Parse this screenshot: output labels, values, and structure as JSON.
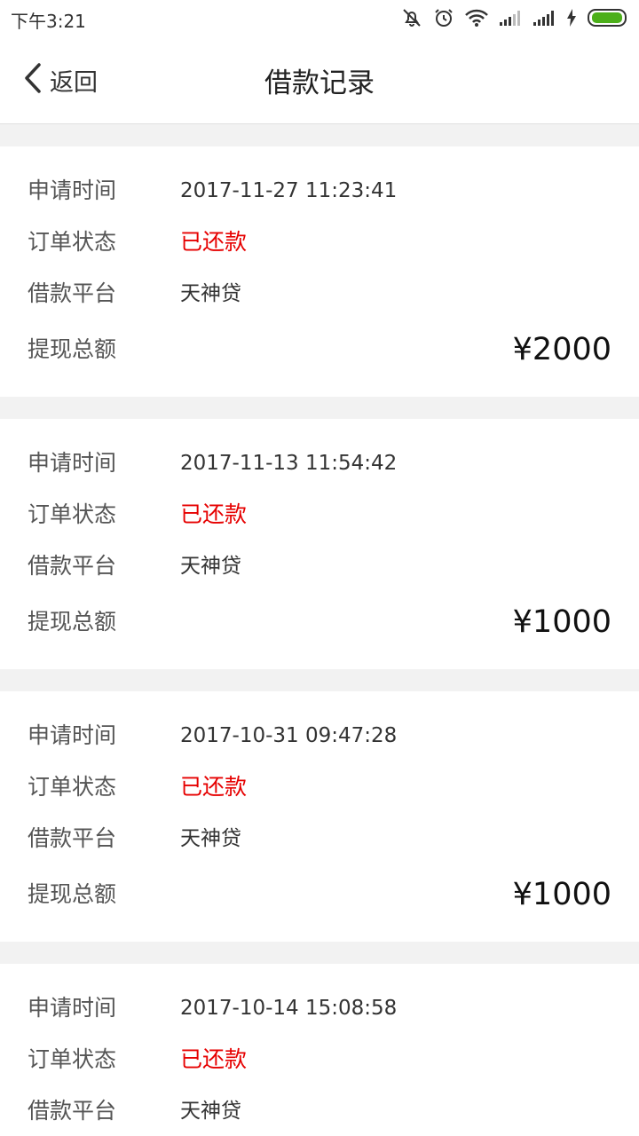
{
  "status_bar": {
    "time": "下午3:21"
  },
  "nav": {
    "back_label": "返回",
    "title": "借款记录"
  },
  "labels": {
    "apply_time": "申请时间",
    "order_status": "订单状态",
    "platform": "借款平台",
    "total": "提现总额"
  },
  "records": [
    {
      "apply_time": "2017-11-27 11:23:41",
      "status": "已还款",
      "platform": "天神贷",
      "amount": "¥2000"
    },
    {
      "apply_time": "2017-11-13 11:54:42",
      "status": "已还款",
      "platform": "天神贷",
      "amount": "¥1000"
    },
    {
      "apply_time": "2017-10-31 09:47:28",
      "status": "已还款",
      "platform": "天神贷",
      "amount": "¥1000"
    },
    {
      "apply_time": "2017-10-14 15:08:58",
      "status": "已还款",
      "platform": "天神贷",
      "amount": ""
    }
  ],
  "colors": {
    "status_red": "#e60000",
    "battery_green": "#4caf1a"
  },
  "icons": [
    "silent-icon",
    "alarm-icon",
    "wifi-icon",
    "signal-icon",
    "charging-icon",
    "battery-icon",
    "chevron-left-icon"
  ]
}
